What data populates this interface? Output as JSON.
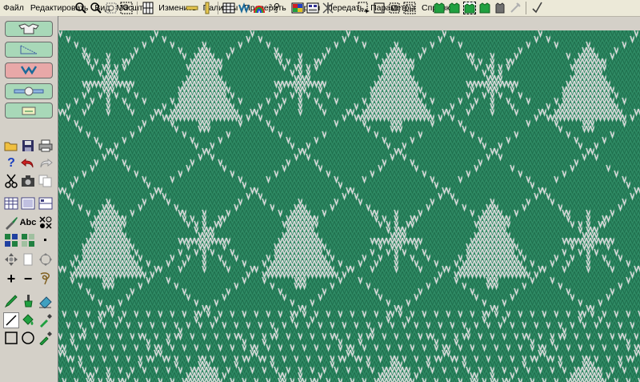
{
  "menu": [
    "Файл",
    "Редактировать",
    "Вид",
    "Масштаб",
    "Изменить",
    "Палитры",
    "Проверить",
    "Формы",
    "Передать",
    "Параметры",
    "Справка"
  ],
  "toolbar_top": {
    "icons": [
      "zoom-in-icon",
      "zoom-out-icon",
      "zoom-fit-icon",
      "zoom-area-icon",
      "grid-view-icon",
      "ruler-h-icon",
      "ruler-v-icon",
      "table-icon",
      "knit-view-icon",
      "rainbow-icon",
      "symbol-view-icon",
      "color-palette-icon",
      "chart-icon",
      "needles-icon",
      "select-rect-icon",
      "select-box-icon",
      "select-fill-icon",
      "select-all-icon",
      "garment-a-icon",
      "garment-b-icon",
      "garment-c-icon",
      "garment-d-icon",
      "garment-e-icon",
      "garment-f-icon",
      "check-icon"
    ]
  },
  "left_panel": {
    "big_buttons": [
      "sweater-front-icon",
      "diagonal-shape-icon",
      "garment-back-icon",
      "needle-bed-icon",
      "card-icon"
    ],
    "tool_abc_label": "Abc",
    "tool_plus": "+",
    "tool_minus": "−"
  },
  "colors": {
    "background": "#2f8a64",
    "stitch_green": "#2e8a63",
    "stitch_green_dark": "#1f6f4d",
    "stitch_white": "#d8d8d8",
    "ui_gray": "#d4d0c8"
  },
  "canvas": {
    "pattern": "christmas-tree-snowflake-argyle-jacquard"
  }
}
